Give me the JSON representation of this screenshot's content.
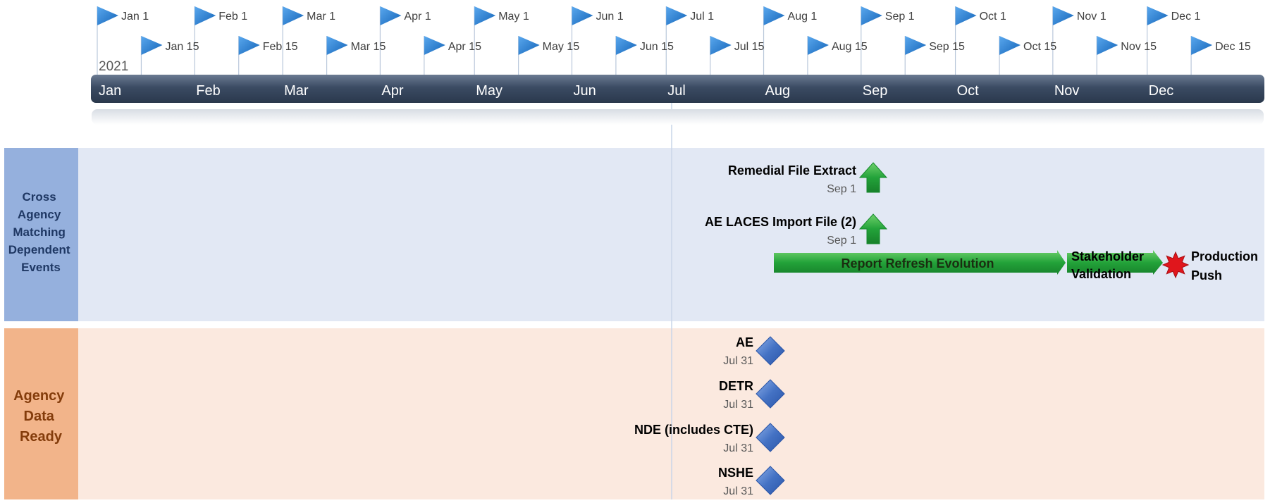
{
  "timeline": {
    "year": "2021",
    "months": [
      "Jan",
      "Feb",
      "Mar",
      "Apr",
      "May",
      "Jun",
      "Jul",
      "Aug",
      "Sep",
      "Oct",
      "Nov",
      "Dec"
    ],
    "markers_first": [
      "Jan 1",
      "Feb 1",
      "Mar 1",
      "Apr 1",
      "May 1",
      "Jun 1",
      "Jul 1",
      "Aug 1",
      "Sep 1",
      "Oct 1",
      "Nov 1",
      "Dec 1"
    ],
    "markers_mid": [
      "Jan 15",
      "Feb 15",
      "Mar 15",
      "Apr 15",
      "May 15",
      "Jun 15",
      "Jul 15",
      "Aug 15",
      "Sep 15",
      "Oct 15",
      "Nov 15",
      "Dec 15"
    ]
  },
  "lanes": [
    {
      "label": "Cross Agency Matching Dependent Events",
      "colors": {
        "band": "#e2e8f4",
        "header": "#95b0dd",
        "text": "#1f3864"
      }
    },
    {
      "label": "Agency Data Ready",
      "colors": {
        "band": "#fbe9df",
        "header": "#f2b48a",
        "text": "#843c0b"
      }
    }
  ],
  "milestones_up": [
    {
      "title": "Remedial File Extract",
      "date": "Sep 1",
      "icon": "up-arrow-icon"
    },
    {
      "title": "AE LACES Import File (2)",
      "date": "Sep 1",
      "icon": "up-arrow-icon"
    }
  ],
  "tasks": [
    {
      "label": "Report Refresh Evolution"
    },
    {
      "label": "Stakeholder Validation"
    }
  ],
  "star_milestone": {
    "label": "Production Push",
    "icon": "star-burst-icon"
  },
  "diamonds": [
    {
      "title": "AE",
      "date": "Jul 31",
      "icon": "diamond-icon"
    },
    {
      "title": "DETR",
      "date": "Jul 31",
      "icon": "diamond-icon"
    },
    {
      "title": "NDE (includes CTE)",
      "date": "Jul 31",
      "icon": "diamond-icon"
    },
    {
      "title": "NSHE",
      "date": "Jul 31",
      "icon": "diamond-icon"
    }
  ],
  "colors": {
    "flag": "#1a78d0",
    "bar_dark": "#2f3f55",
    "bar_text": "#ffffff",
    "task_green": "#22a33c",
    "star_red": "#e0161c",
    "diamond_blue": "#4472c4",
    "today_line": "#c9d6e8"
  }
}
